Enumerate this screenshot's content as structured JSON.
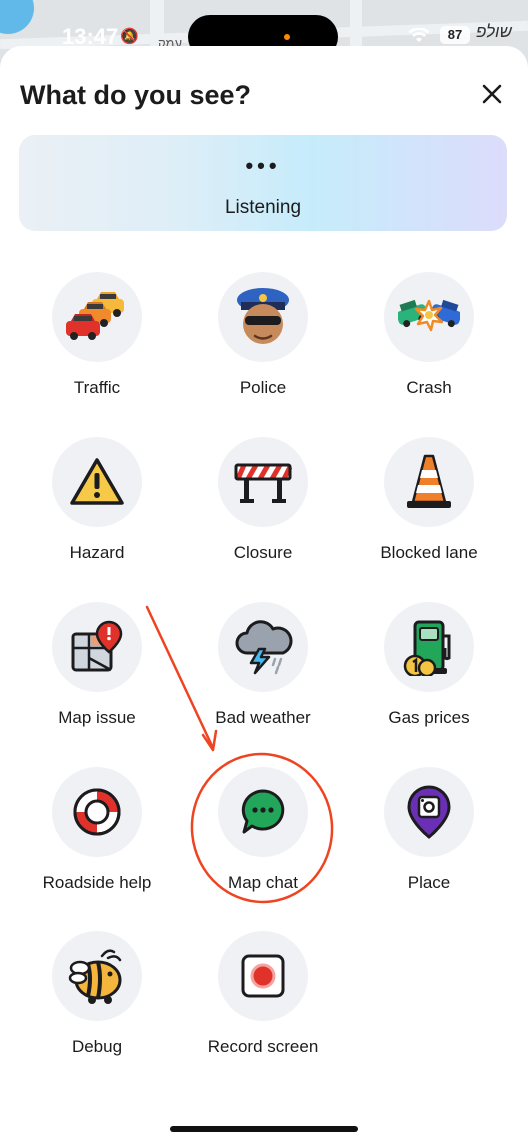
{
  "status_bar": {
    "time": "13:47",
    "battery": "87",
    "carrier_text": "עמק",
    "location_text": "שולפ"
  },
  "sheet": {
    "title": "What do you see?",
    "listening": {
      "dots": "•••",
      "label": "Listening"
    }
  },
  "items": [
    {
      "label": "Traffic",
      "icon": "traffic-icon"
    },
    {
      "label": "Police",
      "icon": "police-icon"
    },
    {
      "label": "Crash",
      "icon": "crash-icon"
    },
    {
      "label": "Hazard",
      "icon": "hazard-icon"
    },
    {
      "label": "Closure",
      "icon": "closure-icon"
    },
    {
      "label": "Blocked lane",
      "icon": "cone-icon"
    },
    {
      "label": "Map issue",
      "icon": "map-issue-icon"
    },
    {
      "label": "Bad weather",
      "icon": "storm-icon"
    },
    {
      "label": "Gas prices",
      "icon": "gas-pump-icon"
    },
    {
      "label": "Roadside help",
      "icon": "lifebuoy-icon"
    },
    {
      "label": "Map chat",
      "icon": "chat-bubble-icon"
    },
    {
      "label": "Place",
      "icon": "place-pin-icon"
    },
    {
      "label": "Debug",
      "icon": "bug-icon"
    },
    {
      "label": "Record screen",
      "icon": "record-icon"
    }
  ],
  "colors": {
    "annotation": "#ee4422",
    "chat_green": "#22a65a",
    "place_purple": "#6b2fb5",
    "circle_bg": "#f0f1f5"
  }
}
